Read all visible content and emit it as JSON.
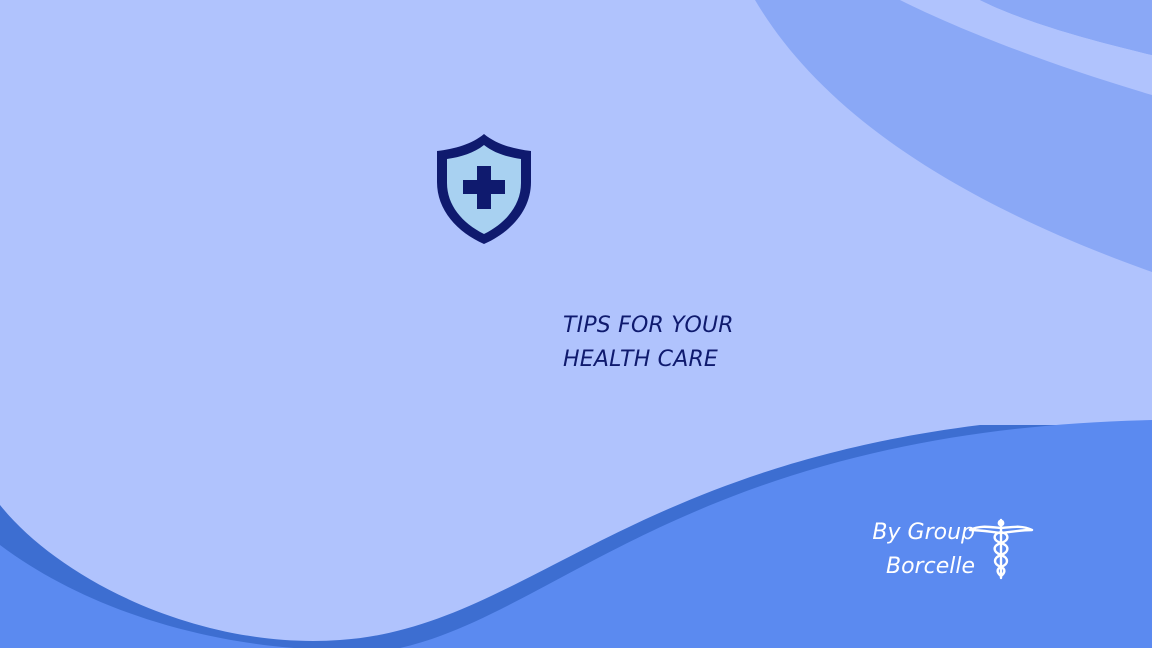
{
  "colors": {
    "background": "#b0c3fd",
    "wave_light": "#8aa8f6",
    "wave_mid": "#3d6ed1",
    "wave_front": "#5b8af0",
    "shield_outline": "#0f1a6e",
    "shield_fill": "#a8d1f1",
    "title_text": "#0f1a6e",
    "byline_text": "#ffffff"
  },
  "title": {
    "line1": "TIPS FOR YOUR",
    "line2": "HEALTH CARE"
  },
  "byline": {
    "line1": "By Group",
    "line2": "Borcelle"
  },
  "icons": {
    "shield": "shield-medical-cross-icon",
    "caduceus": "caduceus-icon"
  }
}
